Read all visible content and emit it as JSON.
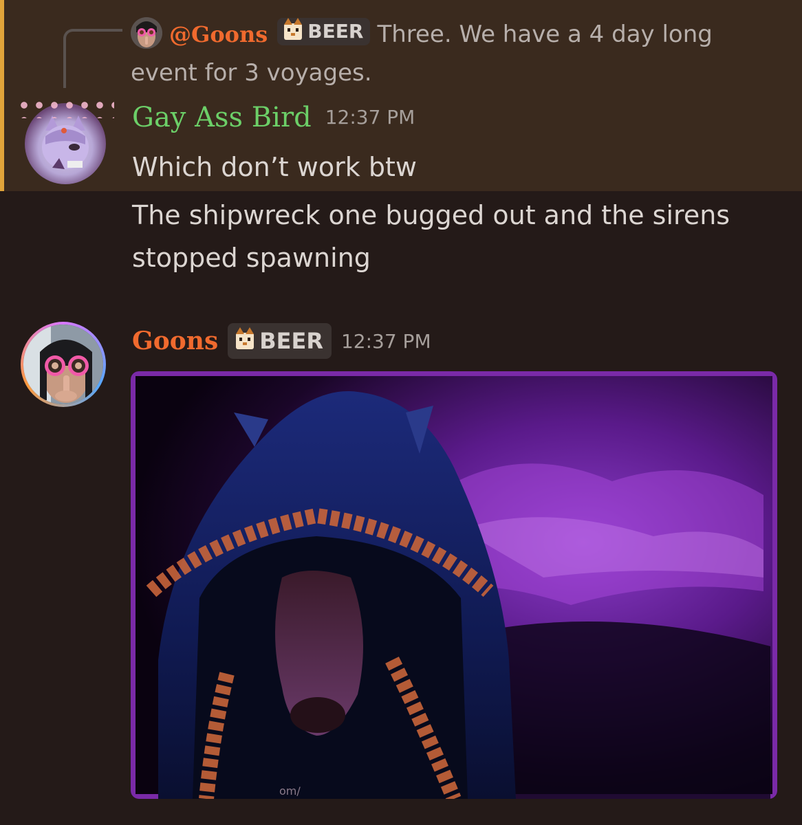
{
  "reply": {
    "mention": "@Goons",
    "badge": "BEER",
    "text": "Three. We have a 4 day long event for 3 voyages."
  },
  "message1": {
    "author": "Gay Ass Bird",
    "author_color": "#6ccf68",
    "timestamp": "12:37 PM",
    "lines": [
      "Which don’t work btw",
      "The shipwreck one bugged out and the sirens stopped spawning"
    ]
  },
  "message2": {
    "author": "Goons",
    "author_color": "#f06a2e",
    "badge": "BEER",
    "timestamp": "12:37 PM",
    "image_caption": "om/"
  },
  "colors": {
    "background": "#241a18",
    "highlight": "#3a2a1e",
    "highlight_bar": "#e0a43a"
  }
}
